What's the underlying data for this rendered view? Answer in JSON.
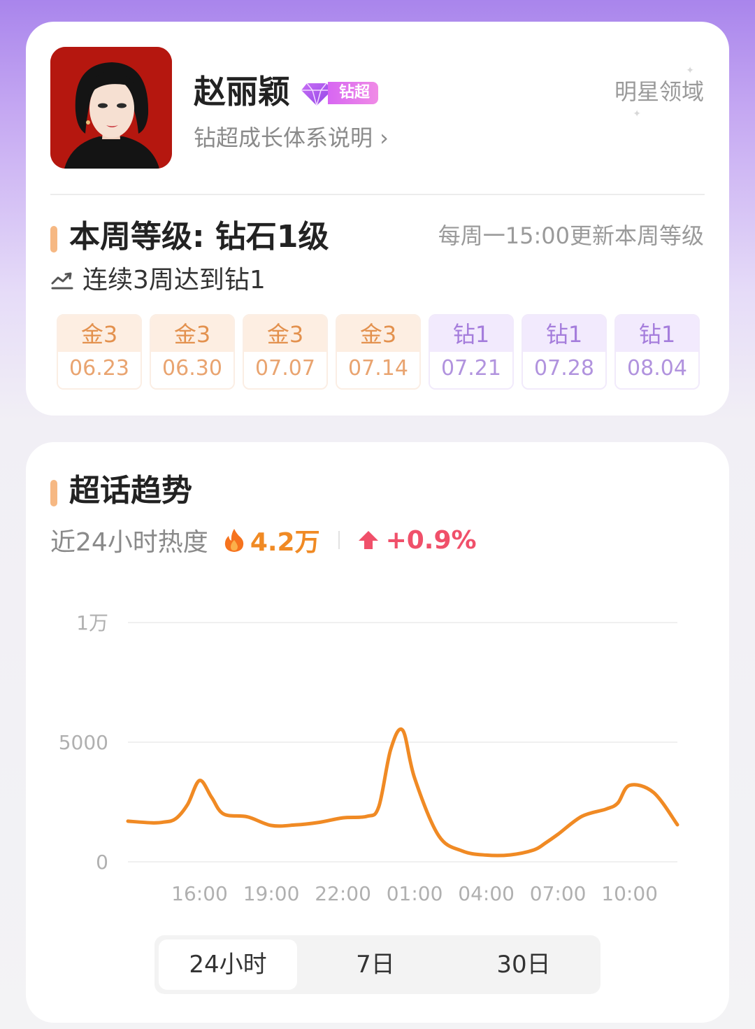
{
  "profile": {
    "name": "赵丽颖",
    "badge_label": "钻超",
    "growth_link": "钻超成长体系说明 ›",
    "region_link": "明星领域"
  },
  "week_level": {
    "title": "本周等级: 钻石1级",
    "update_note": "每周一15:00更新本周等级",
    "streak": "连续3周达到钻1",
    "history": [
      {
        "level": "金3",
        "date": "06.23",
        "tier": "gold"
      },
      {
        "level": "金3",
        "date": "06.30",
        "tier": "gold"
      },
      {
        "level": "金3",
        "date": "07.07",
        "tier": "gold"
      },
      {
        "level": "金3",
        "date": "07.14",
        "tier": "gold"
      },
      {
        "level": "钻1",
        "date": "07.21",
        "tier": "diamond"
      },
      {
        "level": "钻1",
        "date": "07.28",
        "tier": "diamond"
      },
      {
        "level": "钻1",
        "date": "08.04",
        "tier": "diamond"
      }
    ]
  },
  "trend": {
    "title": "超话趋势",
    "heat_label": "近24小时热度",
    "heat_value": "4.2万",
    "heat_change": "+0.9%",
    "tabs": [
      "24小时",
      "7日",
      "30日"
    ],
    "active_tab": 0
  },
  "colors": {
    "accent_orange": "#f08a24",
    "increase_red": "#f0506a",
    "gold_text": "#e3914e",
    "diamond_text": "#a57ddc"
  },
  "chart_data": {
    "type": "line",
    "ylim": [
      0,
      10000
    ],
    "y_ticks": [
      {
        "value": 0,
        "label": "0"
      },
      {
        "value": 5000,
        "label": "5000"
      },
      {
        "value": 10000,
        "label": "1万"
      }
    ],
    "x_ticks": [
      "16:00",
      "19:00",
      "22:00",
      "01:00",
      "04:00",
      "07:00",
      "10:00"
    ],
    "x_tick_hours": [
      3,
      6,
      9,
      12,
      15,
      18,
      21
    ],
    "grid": true,
    "series": [
      {
        "color": "#f08a24",
        "x": [
          0,
          1,
          1.5,
          2,
          2.5,
          3,
          3.5,
          4,
          5,
          6,
          7,
          8,
          9,
          10,
          10.5,
          11,
          11.5,
          12,
          13,
          14,
          15,
          16,
          17,
          17.5,
          18,
          19,
          20,
          20.5,
          21,
          22,
          23
        ],
        "y": [
          1700,
          1630,
          1660,
          1800,
          2400,
          3400,
          2700,
          2000,
          1880,
          1520,
          1540,
          1650,
          1840,
          1900,
          2300,
          4700,
          5500,
          3500,
          1100,
          450,
          280,
          290,
          500,
          800,
          1150,
          1900,
          2200,
          2450,
          3200,
          2900,
          1550
        ]
      }
    ]
  }
}
